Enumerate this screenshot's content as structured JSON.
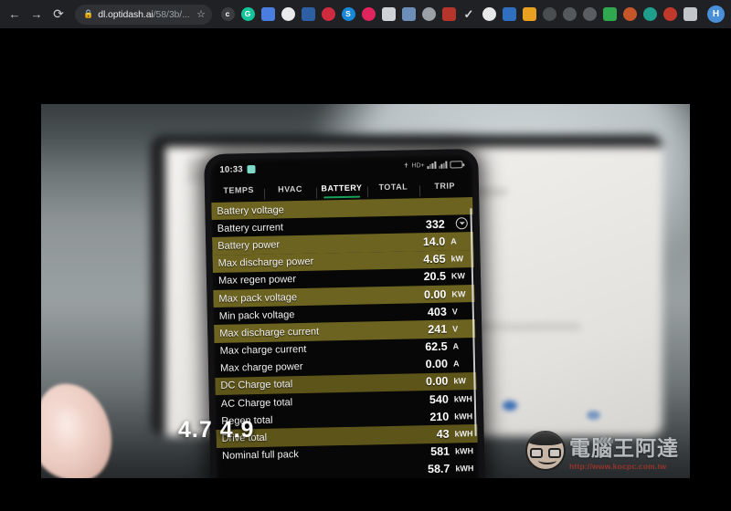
{
  "browser": {
    "back_icon": "back-arrow-icon",
    "forward_icon": "forward-arrow-icon",
    "reload_icon": "reload-icon",
    "lock_icon": "lock-icon",
    "url_domain": "dl.optidash.ai",
    "url_path": "/58/3b/...",
    "star_icon": "bookmark-star-icon",
    "avatar_initial": "H",
    "extensions": [
      {
        "name": "extension-c",
        "glyph": "c",
        "bg": "#3a3c3f",
        "shape": "round"
      },
      {
        "name": "extension-grammar",
        "glyph": "G",
        "bg": "#15c39a",
        "shape": "round"
      },
      {
        "name": "extension-bookmark",
        "glyph": "",
        "bg": "#4a7de0",
        "shape": "square"
      },
      {
        "name": "extension-chat",
        "glyph": "",
        "bg": "#e9eaec",
        "shape": "round"
      },
      {
        "name": "extension-screenshot",
        "glyph": "",
        "bg": "#2e5fa3",
        "shape": "square"
      },
      {
        "name": "extension-heart",
        "glyph": "",
        "bg": "#cf2b3f",
        "shape": "round"
      },
      {
        "name": "extension-skype",
        "glyph": "S",
        "bg": "#1787d8",
        "shape": "round"
      },
      {
        "name": "extension-star-pink",
        "glyph": "",
        "bg": "#e0245e",
        "shape": "round"
      },
      {
        "name": "extension-reader",
        "glyph": "",
        "bg": "#cfd3d7",
        "shape": "square"
      },
      {
        "name": "extension-person",
        "glyph": "",
        "bg": "#6b8fb8",
        "shape": "square"
      },
      {
        "name": "extension-swirl",
        "glyph": "",
        "bg": "#9aa0a6",
        "shape": "round"
      },
      {
        "name": "extension-flag-red",
        "glyph": "",
        "bg": "#b5342c",
        "shape": "square"
      },
      {
        "name": "extension-check",
        "glyph": "✓",
        "bg": "transparent",
        "shape": "plain"
      },
      {
        "name": "extension-record",
        "glyph": "",
        "bg": "#e8e8e8",
        "shape": "round"
      },
      {
        "name": "extension-photo",
        "glyph": "",
        "bg": "#2f6fc0",
        "shape": "square"
      },
      {
        "name": "extension-note-orange",
        "glyph": "",
        "bg": "#e8a020",
        "shape": "square"
      },
      {
        "name": "extension-info",
        "glyph": "",
        "bg": "#4a4d50",
        "shape": "round"
      },
      {
        "name": "extension-location",
        "glyph": "",
        "bg": "#55585c",
        "shape": "round"
      },
      {
        "name": "extension-clock",
        "glyph": "",
        "bg": "#5a5d61",
        "shape": "round"
      },
      {
        "name": "extension-lock-green",
        "glyph": "",
        "bg": "#2fa84f",
        "shape": "square"
      },
      {
        "name": "extension-tree-orange",
        "glyph": "",
        "bg": "#c7552a",
        "shape": "round"
      },
      {
        "name": "extension-pin-teal",
        "glyph": "",
        "bg": "#1f9e8e",
        "shape": "round"
      },
      {
        "name": "extension-pin-red",
        "glyph": "",
        "bg": "#c0392b",
        "shape": "round"
      },
      {
        "name": "extension-grid",
        "glyph": "",
        "bg": "#c2c6ca",
        "shape": "square"
      },
      {
        "name": "extensions-puzzle",
        "glyph": "",
        "bg": "#e8eaed",
        "shape": "square"
      },
      {
        "name": "extension-list",
        "glyph": "≣",
        "bg": "transparent",
        "shape": "plain"
      }
    ]
  },
  "video": {
    "phone": {
      "status_bar": {
        "clock": "10:33",
        "signal_icons": "signal-wifi-battery-icons",
        "network_label": "HD+"
      },
      "tabs": [
        {
          "label": "TEMPS",
          "active": false
        },
        {
          "label": "HVAC",
          "active": false
        },
        {
          "label": "BATTERY",
          "active": true
        },
        {
          "label": "TOTAL",
          "active": false
        },
        {
          "label": "TRIP",
          "active": false
        }
      ],
      "accent_color": "#18a058",
      "highlight_color": "#6d6320",
      "rows": [
        {
          "label": "Battery voltage",
          "value": "332",
          "unit": "",
          "highlight": true
        },
        {
          "label": "Battery current",
          "value": "14.0",
          "unit": "A",
          "highlight": false
        },
        {
          "label": "Battery power",
          "value": "4.65",
          "unit": "kW",
          "highlight": true
        },
        {
          "label": "Max discharge power",
          "value": "20.5",
          "unit": "KW",
          "highlight": true
        },
        {
          "label": "Max regen power",
          "value": "0.00",
          "unit": "KW",
          "highlight": false
        },
        {
          "label": "Max pack voltage",
          "value": "403",
          "unit": "V",
          "highlight": true
        },
        {
          "label": "Min pack voltage",
          "value": "241",
          "unit": "V",
          "highlight": false
        },
        {
          "label": "Max discharge current",
          "value": "62.5",
          "unit": "A",
          "highlight": true
        },
        {
          "label": "Max charge current",
          "value": "0.00",
          "unit": "A",
          "highlight": false
        },
        {
          "label": "Max charge power",
          "value": "0.00",
          "unit": "kW",
          "highlight": false
        },
        {
          "label": "DC Charge total",
          "value": "540",
          "unit": "kWH",
          "highlight": true
        },
        {
          "label": "AC Charge total",
          "value": "210",
          "unit": "kWH",
          "highlight": false
        },
        {
          "label": "Regen total",
          "value": "43",
          "unit": "kWH",
          "highlight": false
        },
        {
          "label": "Drive total",
          "value": "581",
          "unit": "kWH",
          "highlight": true
        },
        {
          "label": "Nominal full pack",
          "value": "58.7",
          "unit": "kWH",
          "highlight": false
        }
      ],
      "expand_icon": "chevron-down-circle-icon",
      "overlay_numbers": "4.7 4.9"
    }
  },
  "watermark": {
    "site_name": "電腦王阿達",
    "url": "http://www.kocpc.com.tw",
    "face_icon": "mascot-face-icon",
    "crown_icon": "crown-icon"
  }
}
